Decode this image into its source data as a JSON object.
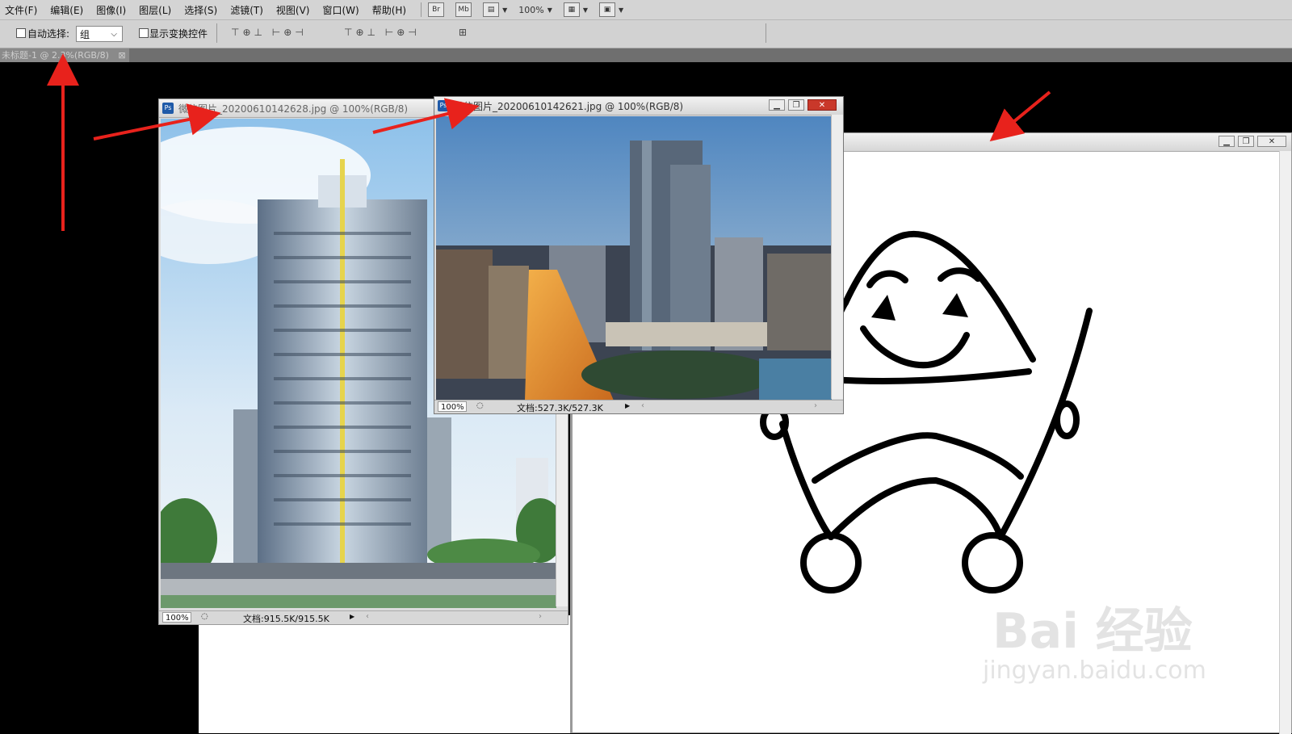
{
  "menu": {
    "items": [
      {
        "label": "文件(F)"
      },
      {
        "label": "编辑(E)"
      },
      {
        "label": "图像(I)"
      },
      {
        "label": "图层(L)"
      },
      {
        "label": "选择(S)"
      },
      {
        "label": "滤镜(T)"
      },
      {
        "label": "视图(V)"
      },
      {
        "label": "窗口(W)"
      },
      {
        "label": "帮助(H)"
      }
    ],
    "bridge_btn": "Br",
    "minibridge_btn": "Mb",
    "zoom_value": "100%"
  },
  "options": {
    "auto_select_label": "自动选择:",
    "auto_select_value": "组",
    "show_transform_label": "显示变换控件"
  },
  "document_tab": {
    "label": "未标题-1 @ 2.3%(RGB/8)",
    "close": "⊠"
  },
  "window_left": {
    "title": "微信图片_20200610142628.jpg @ 100%(RGB/8)",
    "zoom": "100%",
    "doc_info": "文档:915.5K/915.5K"
  },
  "window_right": {
    "title": "微信图片_20200610142621.jpg @ 100%(RGB/8)",
    "zoom": "100%",
    "doc_info": "文档:527.3K/527.3K"
  },
  "watermark": {
    "brand": "Bai  经验",
    "url": "jingyan.baidu.com"
  },
  "colors": {
    "annotation_arrow": "#e8221c",
    "close_button": "#c9382a"
  }
}
